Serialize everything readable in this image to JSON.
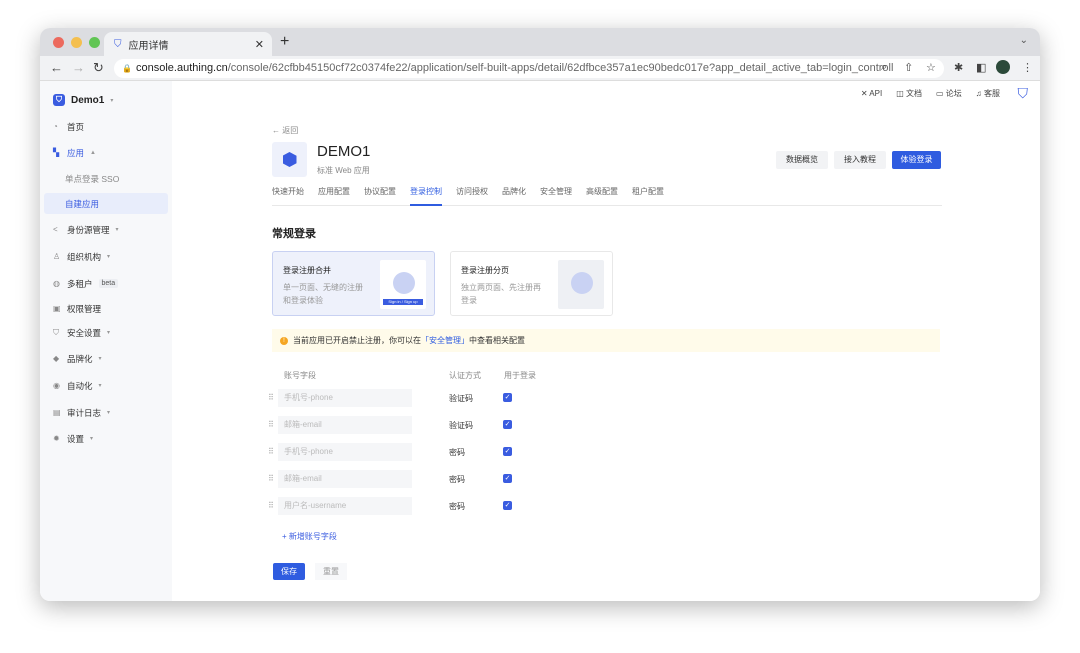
{
  "browser": {
    "tab_title": "应用详情",
    "url_host": "console.authing.cn",
    "url_path": "/console/62cfbb45150cf72c0374fe22/application/self-built-apps/detail/62dfbce357a1ec90bedc017e?app_detail_active_tab=login_controll"
  },
  "sidebar": {
    "org": "Demo1",
    "items": [
      {
        "label": "首页",
        "icon": "pie-icon"
      },
      {
        "label": "应用",
        "icon": "apps-icon",
        "caret": "▲"
      },
      {
        "label": "单点登录 SSO"
      },
      {
        "label": "自建应用"
      },
      {
        "label": "身份源管理",
        "icon": "share-icon",
        "caret": "▾"
      },
      {
        "label": "组织机构",
        "icon": "org-icon",
        "caret": "▾"
      },
      {
        "label": "多租户",
        "icon": "globe-icon",
        "badge": "beta"
      },
      {
        "label": "权限管理",
        "icon": "lock-icon"
      },
      {
        "label": "安全设置",
        "icon": "shield-icon",
        "caret": "▾"
      },
      {
        "label": "品牌化",
        "icon": "brush-icon",
        "caret": "▾"
      },
      {
        "label": "自动化",
        "icon": "robot-icon",
        "caret": "▾"
      },
      {
        "label": "审计日志",
        "icon": "log-icon",
        "caret": "▾"
      },
      {
        "label": "设置",
        "icon": "gear-icon",
        "caret": "▾"
      }
    ]
  },
  "header": {
    "links": [
      "API",
      "文档",
      "论坛",
      "客服"
    ]
  },
  "app": {
    "back": "← 返回",
    "name": "DEMO1",
    "type": "标准 Web 应用",
    "buttons": [
      "数据概览",
      "接入教程",
      "体验登录"
    ],
    "tabs": [
      "快速开始",
      "应用配置",
      "协议配置",
      "登录控制",
      "访问授权",
      "品牌化",
      "安全管理",
      "高级配置",
      "租户配置"
    ]
  },
  "login": {
    "title": "常规登录",
    "cards": [
      {
        "title": "登录注册合并",
        "desc": "单一页面、无缝的注册和登录体验",
        "img_text": "Sign in / Sign up"
      },
      {
        "title": "登录注册分页",
        "desc": "独立两页面、先注册再登录"
      }
    ],
    "notice_pre": "当前应用已开启禁止注册，你可以在",
    "notice_link": "「安全管理」",
    "notice_post": "中查看相关配置",
    "columns": [
      "账号字段",
      "认证方式",
      "用于登录"
    ],
    "rows": [
      {
        "field": "手机号-phone",
        "auth": "验证码",
        "checked": true
      },
      {
        "field": "邮箱-email",
        "auth": "验证码",
        "checked": true
      },
      {
        "field": "手机号-phone",
        "auth": "密码",
        "checked": true
      },
      {
        "field": "邮箱-email",
        "auth": "密码",
        "checked": true
      },
      {
        "field": "用户名-username",
        "auth": "密码",
        "checked": true
      }
    ],
    "add": "+ 新增账号字段",
    "save": "保存",
    "reset": "重置"
  }
}
